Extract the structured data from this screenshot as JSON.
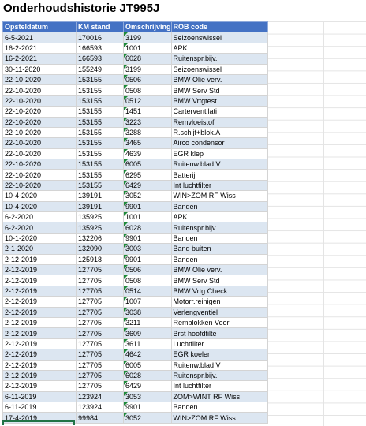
{
  "title": "Onderhoudshistorie JT995J",
  "headers": [
    "Opsteldatum",
    "KM stand",
    "Omschrijving",
    "ROB code"
  ],
  "rows": [
    [
      "6-5-2021",
      "170016",
      "3199",
      "Seizoenswissel"
    ],
    [
      "16-2-2021",
      "166593",
      "1001",
      "APK"
    ],
    [
      "16-2-2021",
      "166593",
      "6028",
      "Ruitenspr.bijv."
    ],
    [
      "30-11-2020",
      "155249",
      "3199",
      "Seizoenswissel"
    ],
    [
      "22-10-2020",
      "153155",
      "0506",
      "BMW Olie verv."
    ],
    [
      "22-10-2020",
      "153155",
      "0508",
      "BMW Serv Std"
    ],
    [
      "22-10-2020",
      "153155",
      "0512",
      "BMW Vrtgtest"
    ],
    [
      "22-10-2020",
      "153155",
      "1451",
      "Carterventilati"
    ],
    [
      "22-10-2020",
      "153155",
      "3223",
      "Remvloeistof"
    ],
    [
      "22-10-2020",
      "153155",
      "3288",
      "R.schijf+blok.A"
    ],
    [
      "22-10-2020",
      "153155",
      "3465",
      "Airco condensor"
    ],
    [
      "22-10-2020",
      "153155",
      "4639",
      "EGR klep"
    ],
    [
      "22-10-2020",
      "153155",
      "6005",
      "Ruitenw.blad V"
    ],
    [
      "22-10-2020",
      "153155",
      "6295",
      "Batterij"
    ],
    [
      "22-10-2020",
      "153155",
      "6429",
      "Int luchtfilter"
    ],
    [
      "10-4-2020",
      "139191",
      "3052",
      "WIN>ZOM RF Wiss"
    ],
    [
      "10-4-2020",
      "139191",
      "9901",
      "Banden"
    ],
    [
      "6-2-2020",
      "135925",
      "1001",
      "APK"
    ],
    [
      "6-2-2020",
      "135925",
      "6028",
      "Ruitenspr.bijv."
    ],
    [
      "10-1-2020",
      "132206",
      "9901",
      "Banden"
    ],
    [
      "2-1-2020",
      "132090",
      "3003",
      "Band buiten"
    ],
    [
      "2-12-2019",
      "125918",
      "9901",
      "Banden"
    ],
    [
      "2-12-2019",
      "127705",
      "0506",
      "BMW Olie verv."
    ],
    [
      "2-12-2019",
      "127705",
      "0508",
      "BMW Serv Std"
    ],
    [
      "2-12-2019",
      "127705",
      "0514",
      "BMW Vrtg Check"
    ],
    [
      "2-12-2019",
      "127705",
      "1007",
      "Motorr.reinigen"
    ],
    [
      "2-12-2019",
      "127705",
      "3038",
      "Verlengventiel"
    ],
    [
      "2-12-2019",
      "127705",
      "3211",
      "Remblokken Voor"
    ],
    [
      "2-12-2019",
      "127705",
      "3609",
      "Brst hoofdfilte"
    ],
    [
      "2-12-2019",
      "127705",
      "3611",
      "Luchtfilter"
    ],
    [
      "2-12-2019",
      "127705",
      "4642",
      "EGR koeler"
    ],
    [
      "2-12-2019",
      "127705",
      "6005",
      "Ruitenw.blad V"
    ],
    [
      "2-12-2019",
      "127705",
      "6028",
      "Ruitenspr.bijv."
    ],
    [
      "2-12-2019",
      "127705",
      "6429",
      "Int luchtfilter"
    ],
    [
      "6-11-2019",
      "123924",
      "3053",
      "ZOM>WINT RF Wiss"
    ],
    [
      "6-11-2019",
      "123924",
      "9901",
      "Banden"
    ],
    [
      "17-4-2019",
      "99984",
      "3052",
      "WIN>ZOM RF Wiss"
    ]
  ],
  "colors": {
    "header_bg": "#4472c4",
    "band_bg": "#dce6f1",
    "indicator": "#1e8a3a"
  }
}
